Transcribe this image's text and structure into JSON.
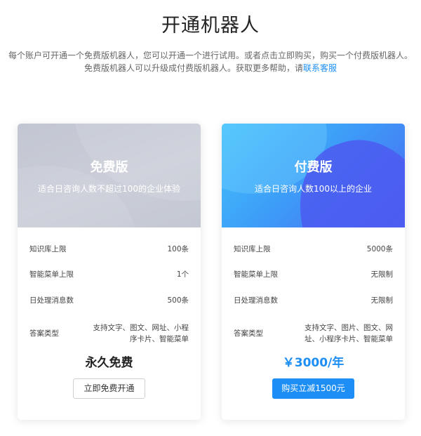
{
  "page": {
    "title": "开通机器人",
    "desc_line1": "每个账户可开通一个免费版机器人，您可以开通一个进行试用。或者点击立即购买，购买一个付费版机器人。",
    "desc_line2_prefix": "免费版机器人可以升级成付费版机器人。获取更多帮助，请",
    "desc_link": "联系客服"
  },
  "plans": [
    {
      "name": "免费版",
      "subtitle": "适合日咨询人数不超过100的企业体验",
      "rows": [
        {
          "label": "知识库上限",
          "value": "100条"
        },
        {
          "label": "智能菜单上限",
          "value": "1个"
        },
        {
          "label": "日处理消息数",
          "value": "500条"
        },
        {
          "label": "答案类型",
          "value_line1": "支持文字、图文、网址、小程",
          "value_line2": "序卡片、智能菜单"
        }
      ],
      "price": "永久免费",
      "button": "立即免费开通"
    },
    {
      "name": "付费版",
      "subtitle": "适合日咨询人数100以上的企业",
      "rows": [
        {
          "label": "知识库上限",
          "value": "5000条"
        },
        {
          "label": "智能菜单上限",
          "value": "无限制"
        },
        {
          "label": "日处理消息数",
          "value": "无限制"
        },
        {
          "label": "答案类型",
          "value_line1": "支持文字、图片、图文、网",
          "value_line2": "址、小程序卡片、智能菜单"
        }
      ],
      "price": "￥3000/年",
      "button": "购买立减1500元"
    }
  ],
  "colors": {
    "accent": "#1c8ef5",
    "free_header": "#c6c9d4",
    "paid_header_start": "#45c4fb",
    "paid_header_end": "#4a66f2"
  }
}
